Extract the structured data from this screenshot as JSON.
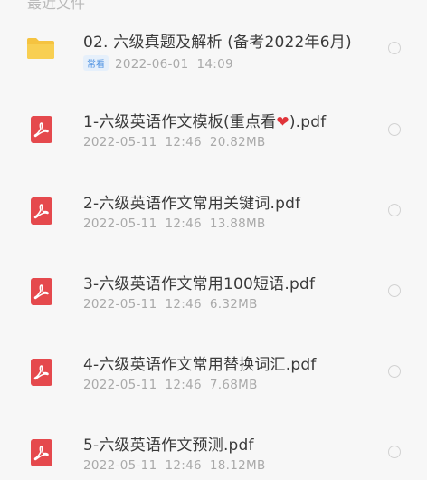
{
  "header": {
    "partial_text": "最近文件",
    "more_icon": "more-dots-icon"
  },
  "files": [
    {
      "icon": "folder-icon",
      "name": "02. 六级真题及解析 (备考2022年6月)",
      "badge": "常看",
      "date": "2022-06-01",
      "time": "14:09",
      "size": ""
    },
    {
      "icon": "pdf-icon",
      "name": "1-六级英语作文模板(重点看",
      "name_suffix": ").pdf",
      "emoji": "❤",
      "date": "2022-05-11",
      "time": "12:46",
      "size": "20.82MB"
    },
    {
      "icon": "pdf-icon",
      "name": "2-六级英语作文常用关键词.pdf",
      "date": "2022-05-11",
      "time": "12:46",
      "size": "13.88MB"
    },
    {
      "icon": "pdf-icon",
      "name": "3-六级英语作文常用100短语.pdf",
      "date": "2022-05-11",
      "time": "12:46",
      "size": "6.32MB"
    },
    {
      "icon": "pdf-icon",
      "name": "4-六级英语作文常用替换词汇.pdf",
      "date": "2022-05-11",
      "time": "12:46",
      "size": "7.68MB"
    },
    {
      "icon": "pdf-icon",
      "name": "5-六级英语作文预测.pdf",
      "date": "2022-05-11",
      "time": "12:46",
      "size": "18.12MB"
    }
  ],
  "colors": {
    "pdf_icon": "#e5494d",
    "folder_icon": "#f5c340",
    "badge_text": "#4a8fe0",
    "meta_text": "#a9a9a9"
  }
}
